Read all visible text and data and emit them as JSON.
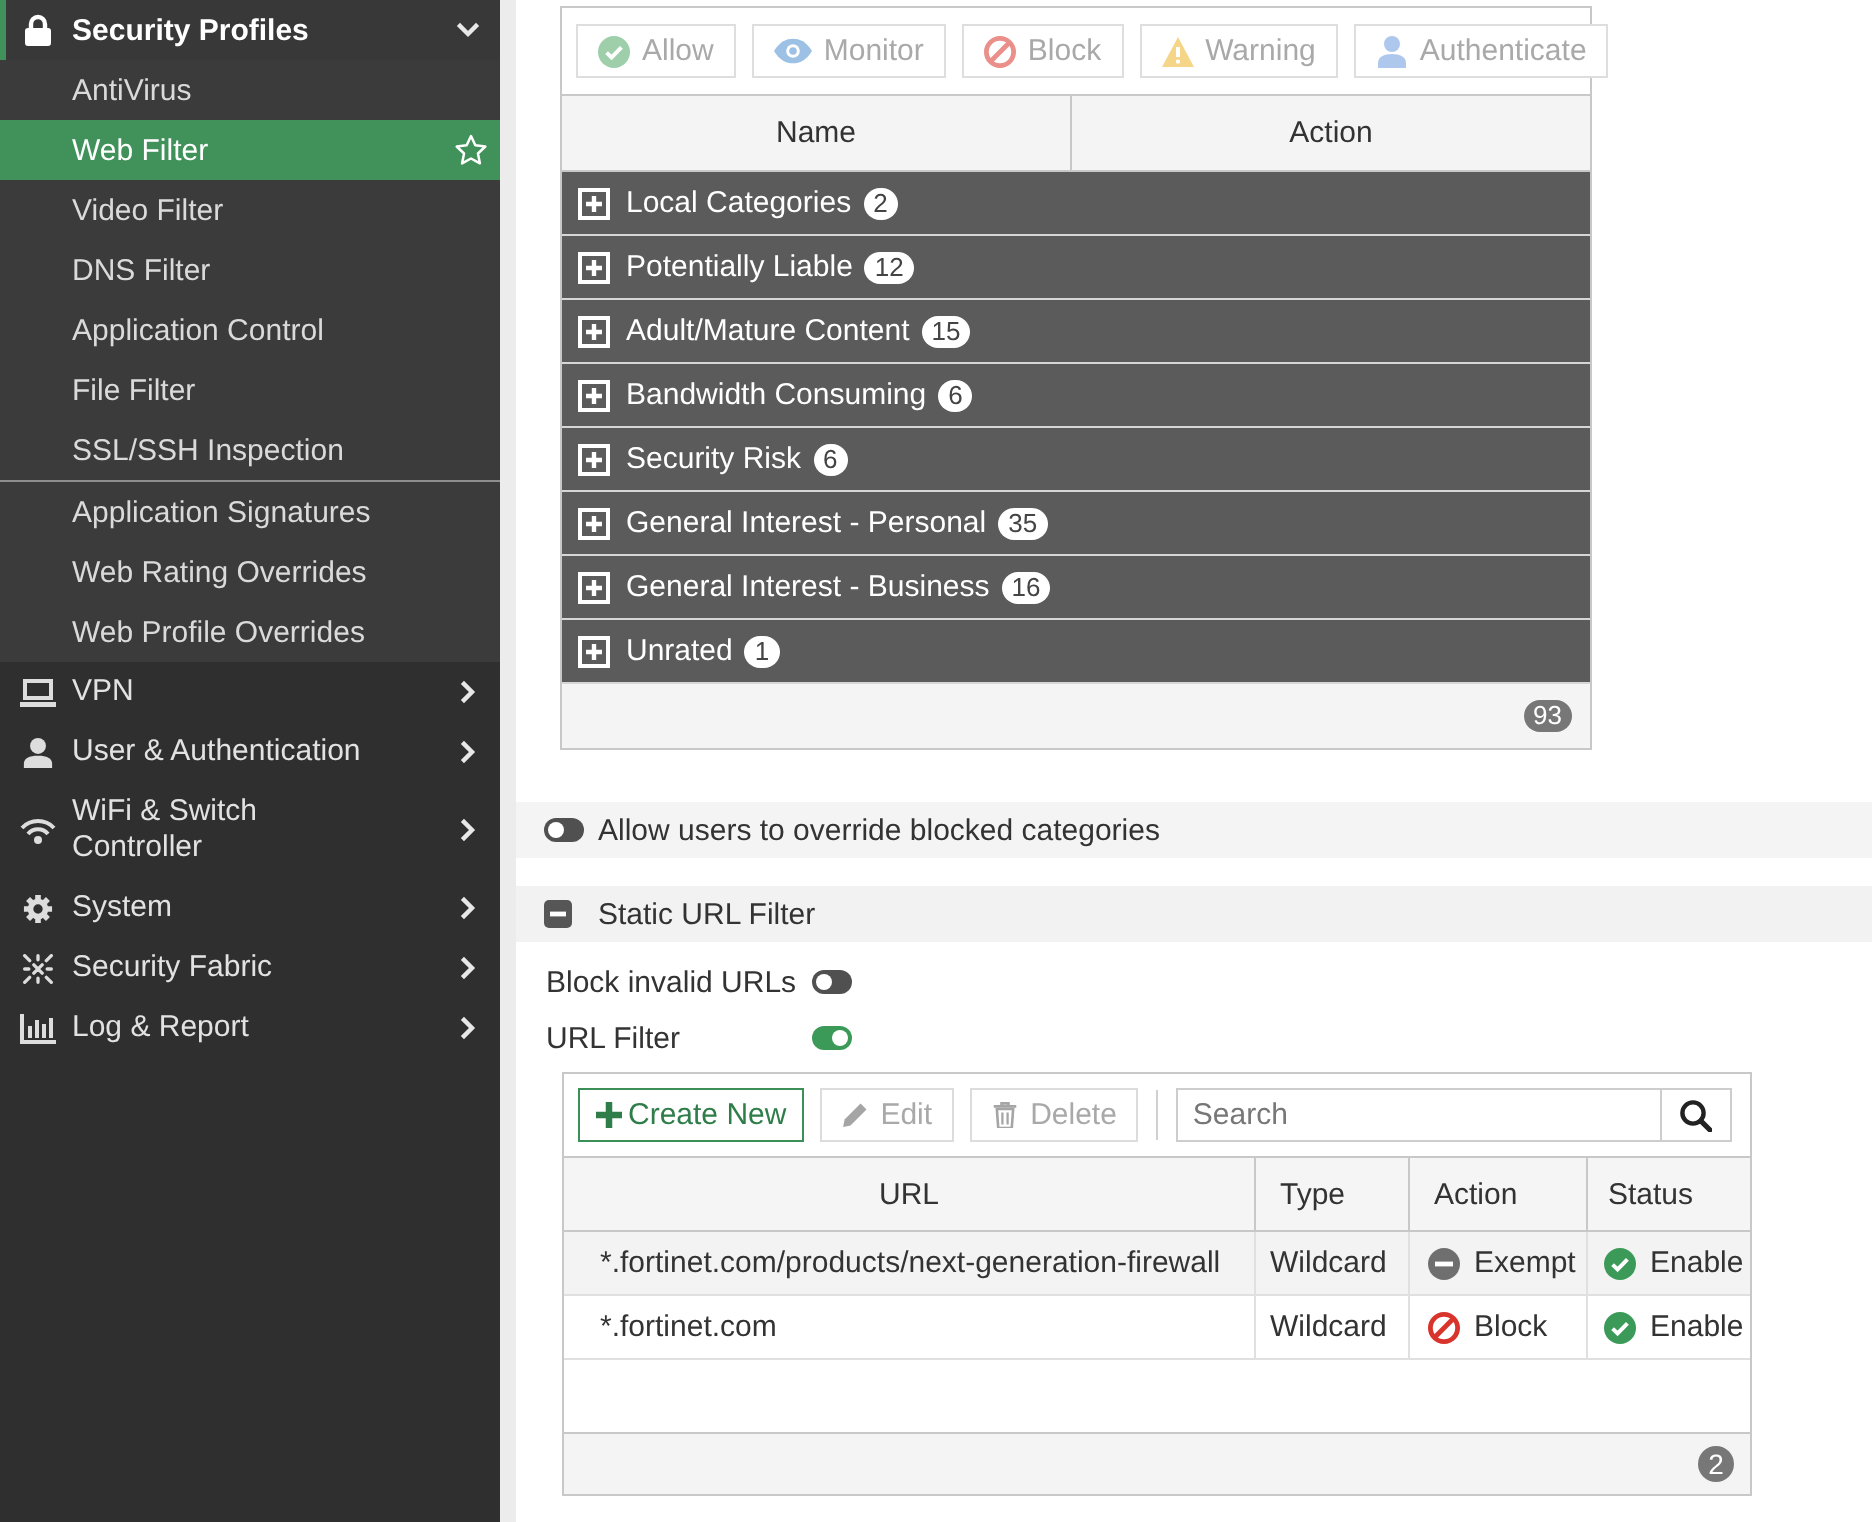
{
  "sidebar": {
    "section": {
      "label": "Security Profiles",
      "expanded": true,
      "groups": [
        [
          {
            "label": "AntiVirus",
            "selected": false
          },
          {
            "label": "Web Filter",
            "selected": true
          },
          {
            "label": "Video Filter",
            "selected": false
          },
          {
            "label": "DNS Filter",
            "selected": false
          },
          {
            "label": "Application Control",
            "selected": false
          },
          {
            "label": "File Filter",
            "selected": false
          },
          {
            "label": "SSL/SSH Inspection",
            "selected": false
          }
        ],
        [
          {
            "label": "Application Signatures",
            "selected": false
          },
          {
            "label": "Web Rating Overrides",
            "selected": false
          },
          {
            "label": "Web Profile Overrides",
            "selected": false
          }
        ]
      ]
    },
    "items": [
      {
        "label": "VPN",
        "expanded": false
      },
      {
        "label": "User & Authentication",
        "expanded": false
      },
      {
        "label": "WiFi & Switch Controller",
        "expanded": false
      },
      {
        "label": "System",
        "expanded": false
      },
      {
        "label": "Security Fabric",
        "expanded": false
      },
      {
        "label": "Log & Report",
        "expanded": false
      }
    ]
  },
  "category_filter": {
    "action_buttons": [
      {
        "label": "Allow",
        "kind": "allow",
        "disabled": true
      },
      {
        "label": "Monitor",
        "kind": "monitor",
        "disabled": true
      },
      {
        "label": "Block",
        "kind": "block",
        "disabled": true
      },
      {
        "label": "Warning",
        "kind": "warning",
        "disabled": true
      },
      {
        "label": "Authenticate",
        "kind": "authenticate",
        "disabled": true
      }
    ],
    "table": {
      "columns": [
        "Name",
        "Action"
      ],
      "groups": [
        {
          "title": {
            "label": "Local Categories",
            "count": "2"
          },
          "expanded": false
        },
        {
          "title": {
            "label": "Potentially Liable",
            "count": "12"
          },
          "expanded": false
        },
        {
          "title": {
            "label": "Adult/Mature Content",
            "count": "15"
          },
          "expanded": false
        },
        {
          "title": {
            "label": "Bandwidth Consuming",
            "count": "6"
          },
          "expanded": false
        },
        {
          "title": {
            "label": "Security Risk",
            "count": "6"
          },
          "expanded": false
        },
        {
          "title": {
            "label": "General Interest - Personal",
            "count": "35"
          },
          "expanded": false
        },
        {
          "title": {
            "label": "General Interest - Business",
            "count": "16"
          },
          "expanded": false
        },
        {
          "title": {
            "label": "Unrated",
            "count": "1"
          },
          "expanded": false
        }
      ],
      "total": "93"
    }
  },
  "override_option": {
    "label": "Allow users to override blocked categories",
    "on": false
  },
  "static_url_filter": {
    "title": "Static URL Filter",
    "expanded": true,
    "settings": [
      {
        "label": "Block invalid URLs",
        "on": false
      },
      {
        "label": "URL Filter",
        "on": true
      }
    ],
    "toolbar": {
      "buttons": [
        {
          "label": "Create New",
          "kind": "create",
          "disabled": false
        },
        {
          "label": "Edit",
          "kind": "edit",
          "disabled": true
        },
        {
          "label": "Delete",
          "kind": "delete",
          "disabled": true
        }
      ],
      "search": {
        "placeholder": "Search"
      }
    },
    "table": {
      "columns": [
        "URL",
        "Type",
        "Action",
        "Status"
      ],
      "rows": [
        {
          "url": "*.fortinet.com/products/next-generation-firewall",
          "type": "Wildcard",
          "action": {
            "label": "Exempt",
            "kind": "exempt"
          },
          "status": {
            "label": "Enable",
            "enabled": true
          },
          "selected": true
        },
        {
          "url": "*.fortinet.com",
          "type": "Wildcard",
          "action": {
            "label": "Block",
            "kind": "block"
          },
          "status": {
            "label": "Enable",
            "enabled": true
          },
          "selected": false
        }
      ],
      "total": "2"
    }
  }
}
